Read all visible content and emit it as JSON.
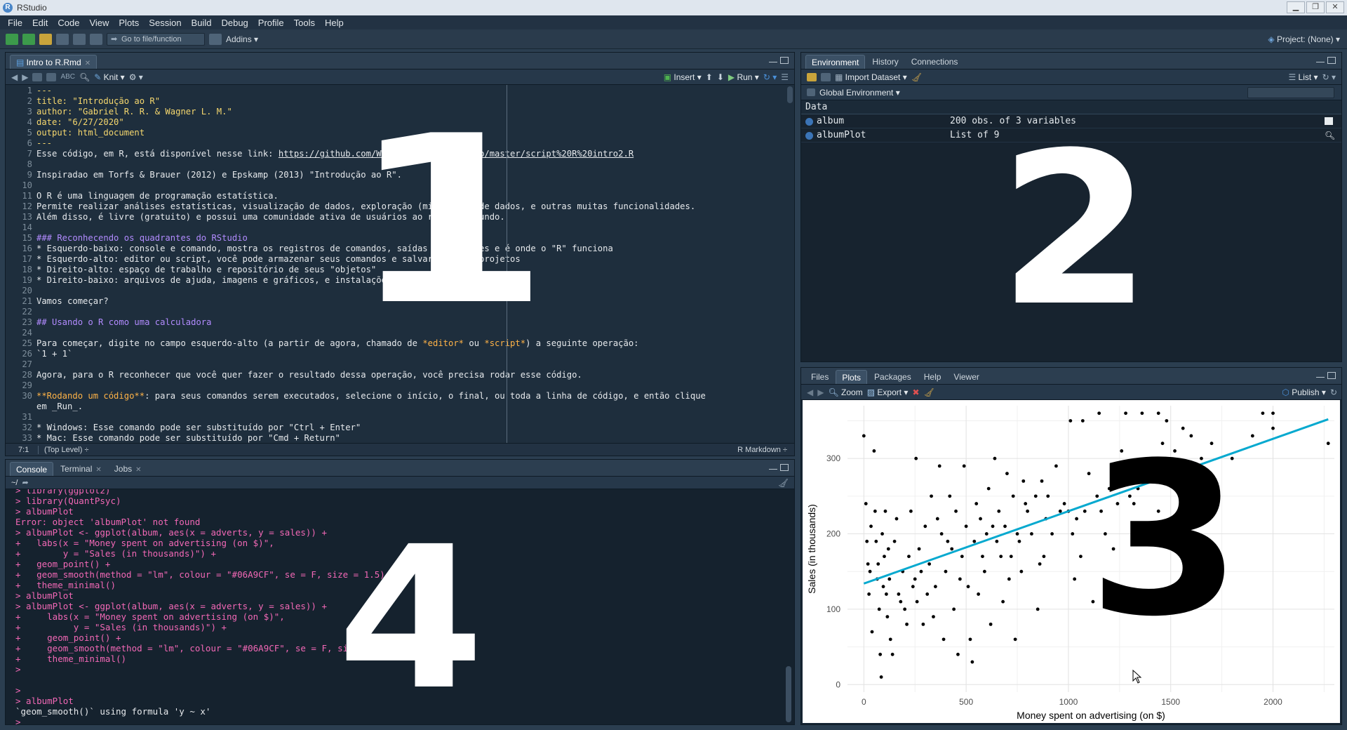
{
  "window": {
    "title": "RStudio",
    "buttons": [
      "▁",
      "❐",
      "✕"
    ]
  },
  "menu": [
    "File",
    "Edit",
    "Code",
    "View",
    "Plots",
    "Session",
    "Build",
    "Debug",
    "Profile",
    "Tools",
    "Help"
  ],
  "toolbar": {
    "goto": "Go to file/function",
    "addins": "Addins ▾",
    "project": "Project: (None) ▾"
  },
  "editor": {
    "tab": "Intro to R.Rmd",
    "knit": "Knit ▾",
    "insert": "Insert ▾",
    "run": "Run ▾",
    "lines": [
      {
        "n": "1",
        "parts": [
          {
            "t": "---",
            "c": "y"
          }
        ]
      },
      {
        "n": "2",
        "parts": [
          {
            "t": "title: \"Introdução ao R\"",
            "c": "y"
          }
        ]
      },
      {
        "n": "3",
        "parts": [
          {
            "t": "author: \"Gabriel R. R. & Wagner L. M.\"",
            "c": "y"
          }
        ]
      },
      {
        "n": "4",
        "parts": [
          {
            "t": "date: \"6/27/2020\"",
            "c": "y"
          }
        ]
      },
      {
        "n": "5",
        "parts": [
          {
            "t": "output: html_document",
            "c": "y"
          }
        ]
      },
      {
        "n": "6",
        "parts": [
          {
            "t": "---",
            "c": "y"
          }
        ]
      },
      {
        "n": "7",
        "parts": [
          {
            "t": "Esse código, em R, está disponível nesse link: ",
            "c": "code"
          },
          {
            "t": "https://github.com/WagnerLM/quanti2/blob/master/script%20R%20intro2.R",
            "c": "code u"
          }
        ]
      },
      {
        "n": "8",
        "parts": []
      },
      {
        "n": "9",
        "parts": [
          {
            "t": "Inspiradao em Torfs & Brauer (2012) e Epskamp (2013) \"Introdução ao R\".",
            "c": "code"
          }
        ]
      },
      {
        "n": "10",
        "parts": []
      },
      {
        "n": "11",
        "parts": [
          {
            "t": "O R é uma linguagem de programação estatística.",
            "c": "code"
          }
        ]
      },
      {
        "n": "12",
        "parts": [
          {
            "t": "Permite realizar análises estatísticas, visualização de dados, exploração (mineração) de dados, e outras muitas funcionalidades.",
            "c": "code"
          }
        ]
      },
      {
        "n": "13",
        "parts": [
          {
            "t": "Além disso, é livre (gratuito) e possui uma comunidade ativa de usuários ao redor do mundo.",
            "c": "code"
          }
        ]
      },
      {
        "n": "14",
        "parts": []
      },
      {
        "n": "15",
        "parts": [
          {
            "t": "### Reconhecendo os quadrantes do RStudio",
            "c": "p"
          }
        ]
      },
      {
        "n": "16",
        "parts": [
          {
            "t": "* Esquerdo-baixo: console e comando, mostra os registros de comandos, saídas de análises e é onde o \"R\" funciona",
            "c": "code"
          }
        ]
      },
      {
        "n": "17",
        "parts": [
          {
            "t": "* Esquerdo-alto: editor ou script, você pode armazenar seus comandos e salvar os seus projetos",
            "c": "code"
          }
        ]
      },
      {
        "n": "18",
        "parts": [
          {
            "t": "* Direito-alto: espaço de trabalho e repositório de seus \"objetos\"",
            "c": "code"
          }
        ]
      },
      {
        "n": "19",
        "parts": [
          {
            "t": "* Direito-baixo: arquivos de ajuda, imagens e gráficos, e instalações dos pacotes",
            "c": "code"
          }
        ]
      },
      {
        "n": "20",
        "parts": []
      },
      {
        "n": "21",
        "parts": [
          {
            "t": "Vamos começar?",
            "c": "code"
          }
        ]
      },
      {
        "n": "22",
        "parts": []
      },
      {
        "n": "23",
        "parts": [
          {
            "t": "## Usando o R como uma calculadora",
            "c": "p"
          }
        ]
      },
      {
        "n": "24",
        "parts": []
      },
      {
        "n": "25",
        "parts": [
          {
            "t": "Para começar, digite no campo esquerdo-alto (a partir de agora, chamado de ",
            "c": "code"
          },
          {
            "t": "*editor*",
            "c": "o"
          },
          {
            "t": " ou ",
            "c": "code"
          },
          {
            "t": "*script*",
            "c": "o"
          },
          {
            "t": ") a seguinte operação:",
            "c": "code"
          }
        ]
      },
      {
        "n": "26",
        "parts": [
          {
            "t": "`1 + 1`",
            "c": "code"
          }
        ]
      },
      {
        "n": "27",
        "parts": []
      },
      {
        "n": "28",
        "parts": [
          {
            "t": "Agora, para o R reconhecer que você quer fazer o resultado dessa operação, você precisa rodar esse código.",
            "c": "code"
          }
        ]
      },
      {
        "n": "29",
        "parts": []
      },
      {
        "n": "30",
        "parts": [
          {
            "t": "**Rodando um código**",
            "c": "o"
          },
          {
            "t": ": para seus comandos serem executados, selecione o início, o final, ou toda a linha de código, e então clique",
            "c": "code"
          }
        ]
      },
      {
        "n": "",
        "parts": [
          {
            "t": "em _Run_.",
            "c": "code"
          }
        ]
      },
      {
        "n": "31",
        "parts": []
      },
      {
        "n": "32",
        "parts": [
          {
            "t": "* Windows: Esse comando pode ser substituído por \"Ctrl + Enter\"",
            "c": "code"
          }
        ]
      },
      {
        "n": "33",
        "parts": [
          {
            "t": "* Mac: Esse comando pode ser substituído por \"Cmd + Return\"",
            "c": "code"
          }
        ]
      }
    ],
    "status_pos": "7:1",
    "status_level": "(Top Level) ÷",
    "status_mode": "R Markdown ÷"
  },
  "environment": {
    "tabs": [
      "Environment",
      "History",
      "Connections"
    ],
    "import": "Import Dataset ▾",
    "list": "List ▾",
    "scope": "Global Environment ▾",
    "section": "Data",
    "rows": [
      {
        "name": "album",
        "value": "200 obs. of 3 variables"
      },
      {
        "name": "albumPlot",
        "value": "List of 9"
      }
    ]
  },
  "files": {
    "tabs": [
      "Files",
      "Plots",
      "Packages",
      "Help",
      "Viewer"
    ],
    "zoom": "Zoom",
    "export": "Export ▾",
    "publish": "Publish ▾"
  },
  "console": {
    "tabs": [
      "Console",
      "Terminal",
      "Jobs"
    ],
    "path": "~/",
    "lines": [
      {
        "t": "> library(ggplot2)",
        "c": "cmd"
      },
      {
        "t": "> library(QuantPsyc)",
        "c": "cmd"
      },
      {
        "t": "> albumPlot",
        "c": "cmd"
      },
      {
        "t": "Error: object 'albumPlot' not found",
        "c": "err"
      },
      {
        "t": "> albumPlot <- ggplot(album, aes(x = adverts, y = sales)) +",
        "c": "cmd"
      },
      {
        "t": "+   labs(x = \"Money spent on advertising (on $)\",",
        "c": "cmd"
      },
      {
        "t": "+        y = \"Sales (in thousands)\") +",
        "c": "cmd"
      },
      {
        "t": "+   geom_point() +",
        "c": "cmd"
      },
      {
        "t": "+   geom_smooth(method = \"lm\", colour = \"#06A9CF\", se = F, size = 1.5) +",
        "c": "cmd"
      },
      {
        "t": "+   theme_minimal()",
        "c": "cmd"
      },
      {
        "t": "> albumPlot",
        "c": "cmd"
      },
      {
        "t": "> albumPlot <- ggplot(album, aes(x = adverts, y = sales)) +",
        "c": "cmd"
      },
      {
        "t": "+     labs(x = \"Money spent on advertising (on $)\",",
        "c": "cmd"
      },
      {
        "t": "+          y = \"Sales (in thousands)\") +",
        "c": "cmd"
      },
      {
        "t": "+     geom_point() +",
        "c": "cmd"
      },
      {
        "t": "+     geom_smooth(method = \"lm\", colour = \"#06A9CF\", se = F, size = 1.5) +",
        "c": "cmd"
      },
      {
        "t": "+     theme_minimal()",
        "c": "cmd"
      },
      {
        "t": ">",
        "c": "cmd"
      },
      {
        "t": "",
        "c": "cmd"
      },
      {
        "t": ">",
        "c": "cmd"
      },
      {
        "t": "> albumPlot",
        "c": "cmd"
      },
      {
        "t": "`geom_smooth()` using formula 'y ~ x'",
        "c": "out"
      },
      {
        "t": "> ",
        "c": "prompt"
      }
    ]
  },
  "overlays": {
    "one": "1",
    "two": "2",
    "three": "3",
    "four": "4"
  },
  "colors": {
    "smooth_line": "#06A9CF",
    "background": "#2b3e50",
    "points": "#000000"
  },
  "chart_data": {
    "type": "scatter",
    "title": "",
    "xlabel": "Money spent on advertising (on $)",
    "ylabel": "Sales (in thousands)",
    "xlim": [
      -80,
      2300
    ],
    "ylim": [
      -10,
      370
    ],
    "xticks": [
      0,
      500,
      1000,
      1500,
      2000
    ],
    "yticks": [
      0,
      100,
      200,
      300
    ],
    "grid": true,
    "trend_line": {
      "method": "lm",
      "color": "#06A9CF",
      "x": [
        0,
        2270
      ],
      "y": [
        134,
        352
      ]
    },
    "points": [
      [
        0,
        330
      ],
      [
        10,
        240
      ],
      [
        15,
        190
      ],
      [
        20,
        160
      ],
      [
        25,
        120
      ],
      [
        30,
        150
      ],
      [
        35,
        210
      ],
      [
        40,
        70
      ],
      [
        50,
        310
      ],
      [
        55,
        230
      ],
      [
        60,
        190
      ],
      [
        65,
        140
      ],
      [
        70,
        160
      ],
      [
        75,
        100
      ],
      [
        80,
        40
      ],
      [
        85,
        10
      ],
      [
        90,
        200
      ],
      [
        95,
        130
      ],
      [
        100,
        170
      ],
      [
        105,
        230
      ],
      [
        110,
        120
      ],
      [
        115,
        90
      ],
      [
        120,
        180
      ],
      [
        125,
        140
      ],
      [
        130,
        60
      ],
      [
        140,
        40
      ],
      [
        150,
        190
      ],
      [
        160,
        220
      ],
      [
        170,
        120
      ],
      [
        180,
        110
      ],
      [
        190,
        150
      ],
      [
        200,
        100
      ],
      [
        210,
        80
      ],
      [
        220,
        170
      ],
      [
        230,
        230
      ],
      [
        240,
        130
      ],
      [
        250,
        140
      ],
      [
        255,
        300
      ],
      [
        260,
        110
      ],
      [
        270,
        180
      ],
      [
        280,
        150
      ],
      [
        290,
        80
      ],
      [
        300,
        210
      ],
      [
        310,
        120
      ],
      [
        320,
        160
      ],
      [
        330,
        250
      ],
      [
        340,
        90
      ],
      [
        350,
        130
      ],
      [
        360,
        220
      ],
      [
        370,
        290
      ],
      [
        380,
        200
      ],
      [
        390,
        60
      ],
      [
        400,
        150
      ],
      [
        410,
        190
      ],
      [
        420,
        250
      ],
      [
        430,
        180
      ],
      [
        440,
        100
      ],
      [
        450,
        230
      ],
      [
        460,
        40
      ],
      [
        470,
        140
      ],
      [
        480,
        170
      ],
      [
        490,
        290
      ],
      [
        500,
        210
      ],
      [
        510,
        130
      ],
      [
        520,
        60
      ],
      [
        530,
        30
      ],
      [
        540,
        190
      ],
      [
        550,
        240
      ],
      [
        560,
        120
      ],
      [
        570,
        220
      ],
      [
        580,
        170
      ],
      [
        590,
        150
      ],
      [
        600,
        200
      ],
      [
        610,
        260
      ],
      [
        620,
        80
      ],
      [
        630,
        210
      ],
      [
        640,
        300
      ],
      [
        650,
        190
      ],
      [
        660,
        230
      ],
      [
        670,
        170
      ],
      [
        680,
        110
      ],
      [
        690,
        210
      ],
      [
        700,
        280
      ],
      [
        710,
        140
      ],
      [
        720,
        170
      ],
      [
        730,
        250
      ],
      [
        740,
        60
      ],
      [
        750,
        200
      ],
      [
        760,
        190
      ],
      [
        770,
        150
      ],
      [
        780,
        270
      ],
      [
        790,
        240
      ],
      [
        800,
        230
      ],
      [
        820,
        200
      ],
      [
        840,
        250
      ],
      [
        850,
        100
      ],
      [
        860,
        160
      ],
      [
        870,
        270
      ],
      [
        880,
        170
      ],
      [
        890,
        220
      ],
      [
        900,
        250
      ],
      [
        920,
        200
      ],
      [
        940,
        290
      ],
      [
        960,
        230
      ],
      [
        980,
        240
      ],
      [
        1000,
        230
      ],
      [
        1010,
        350
      ],
      [
        1020,
        200
      ],
      [
        1030,
        140
      ],
      [
        1040,
        220
      ],
      [
        1060,
        170
      ],
      [
        1080,
        230
      ],
      [
        1100,
        280
      ],
      [
        1120,
        110
      ],
      [
        1140,
        250
      ],
      [
        1160,
        230
      ],
      [
        1180,
        200
      ],
      [
        1200,
        260
      ],
      [
        1220,
        180
      ],
      [
        1240,
        240
      ],
      [
        1260,
        310
      ],
      [
        1280,
        290
      ],
      [
        1300,
        250
      ],
      [
        1320,
        240
      ],
      [
        1340,
        260
      ],
      [
        1360,
        290
      ],
      [
        1380,
        270
      ],
      [
        1420,
        300
      ],
      [
        1440,
        230
      ],
      [
        1460,
        320
      ],
      [
        1480,
        350
      ],
      [
        1520,
        310
      ],
      [
        1560,
        340
      ],
      [
        1600,
        330
      ],
      [
        1650,
        300
      ],
      [
        1700,
        320
      ],
      [
        1800,
        300
      ],
      [
        1900,
        330
      ],
      [
        1950,
        360
      ],
      [
        2000,
        340
      ],
      [
        2270,
        320
      ],
      [
        1150,
        360
      ],
      [
        1280,
        360
      ],
      [
        1360,
        360
      ],
      [
        1440,
        360
      ],
      [
        1070,
        350
      ],
      [
        2000,
        360
      ]
    ]
  }
}
